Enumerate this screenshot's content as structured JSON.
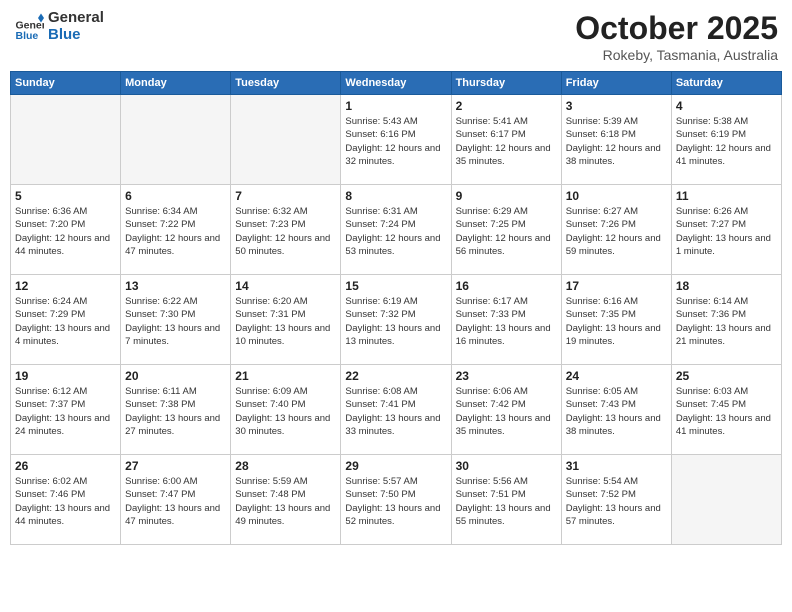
{
  "header": {
    "logo_line1": "General",
    "logo_line2": "Blue",
    "month": "October 2025",
    "location": "Rokeby, Tasmania, Australia"
  },
  "days_of_week": [
    "Sunday",
    "Monday",
    "Tuesday",
    "Wednesday",
    "Thursday",
    "Friday",
    "Saturday"
  ],
  "weeks": [
    [
      {
        "day": "",
        "empty": true
      },
      {
        "day": "",
        "empty": true
      },
      {
        "day": "",
        "empty": true
      },
      {
        "day": "1",
        "sunrise": "5:43 AM",
        "sunset": "6:16 PM",
        "daylight": "12 hours and 32 minutes."
      },
      {
        "day": "2",
        "sunrise": "5:41 AM",
        "sunset": "6:17 PM",
        "daylight": "12 hours and 35 minutes."
      },
      {
        "day": "3",
        "sunrise": "5:39 AM",
        "sunset": "6:18 PM",
        "daylight": "12 hours and 38 minutes."
      },
      {
        "day": "4",
        "sunrise": "5:38 AM",
        "sunset": "6:19 PM",
        "daylight": "12 hours and 41 minutes."
      }
    ],
    [
      {
        "day": "5",
        "sunrise": "6:36 AM",
        "sunset": "7:20 PM",
        "daylight": "12 hours and 44 minutes."
      },
      {
        "day": "6",
        "sunrise": "6:34 AM",
        "sunset": "7:22 PM",
        "daylight": "12 hours and 47 minutes."
      },
      {
        "day": "7",
        "sunrise": "6:32 AM",
        "sunset": "7:23 PM",
        "daylight": "12 hours and 50 minutes."
      },
      {
        "day": "8",
        "sunrise": "6:31 AM",
        "sunset": "7:24 PM",
        "daylight": "12 hours and 53 minutes."
      },
      {
        "day": "9",
        "sunrise": "6:29 AM",
        "sunset": "7:25 PM",
        "daylight": "12 hours and 56 minutes."
      },
      {
        "day": "10",
        "sunrise": "6:27 AM",
        "sunset": "7:26 PM",
        "daylight": "12 hours and 59 minutes."
      },
      {
        "day": "11",
        "sunrise": "6:26 AM",
        "sunset": "7:27 PM",
        "daylight": "13 hours and 1 minute."
      }
    ],
    [
      {
        "day": "12",
        "sunrise": "6:24 AM",
        "sunset": "7:29 PM",
        "daylight": "13 hours and 4 minutes."
      },
      {
        "day": "13",
        "sunrise": "6:22 AM",
        "sunset": "7:30 PM",
        "daylight": "13 hours and 7 minutes."
      },
      {
        "day": "14",
        "sunrise": "6:20 AM",
        "sunset": "7:31 PM",
        "daylight": "13 hours and 10 minutes."
      },
      {
        "day": "15",
        "sunrise": "6:19 AM",
        "sunset": "7:32 PM",
        "daylight": "13 hours and 13 minutes."
      },
      {
        "day": "16",
        "sunrise": "6:17 AM",
        "sunset": "7:33 PM",
        "daylight": "13 hours and 16 minutes."
      },
      {
        "day": "17",
        "sunrise": "6:16 AM",
        "sunset": "7:35 PM",
        "daylight": "13 hours and 19 minutes."
      },
      {
        "day": "18",
        "sunrise": "6:14 AM",
        "sunset": "7:36 PM",
        "daylight": "13 hours and 21 minutes."
      }
    ],
    [
      {
        "day": "19",
        "sunrise": "6:12 AM",
        "sunset": "7:37 PM",
        "daylight": "13 hours and 24 minutes."
      },
      {
        "day": "20",
        "sunrise": "6:11 AM",
        "sunset": "7:38 PM",
        "daylight": "13 hours and 27 minutes."
      },
      {
        "day": "21",
        "sunrise": "6:09 AM",
        "sunset": "7:40 PM",
        "daylight": "13 hours and 30 minutes."
      },
      {
        "day": "22",
        "sunrise": "6:08 AM",
        "sunset": "7:41 PM",
        "daylight": "13 hours and 33 minutes."
      },
      {
        "day": "23",
        "sunrise": "6:06 AM",
        "sunset": "7:42 PM",
        "daylight": "13 hours and 35 minutes."
      },
      {
        "day": "24",
        "sunrise": "6:05 AM",
        "sunset": "7:43 PM",
        "daylight": "13 hours and 38 minutes."
      },
      {
        "day": "25",
        "sunrise": "6:03 AM",
        "sunset": "7:45 PM",
        "daylight": "13 hours and 41 minutes."
      }
    ],
    [
      {
        "day": "26",
        "sunrise": "6:02 AM",
        "sunset": "7:46 PM",
        "daylight": "13 hours and 44 minutes."
      },
      {
        "day": "27",
        "sunrise": "6:00 AM",
        "sunset": "7:47 PM",
        "daylight": "13 hours and 47 minutes."
      },
      {
        "day": "28",
        "sunrise": "5:59 AM",
        "sunset": "7:48 PM",
        "daylight": "13 hours and 49 minutes."
      },
      {
        "day": "29",
        "sunrise": "5:57 AM",
        "sunset": "7:50 PM",
        "daylight": "13 hours and 52 minutes."
      },
      {
        "day": "30",
        "sunrise": "5:56 AM",
        "sunset": "7:51 PM",
        "daylight": "13 hours and 55 minutes."
      },
      {
        "day": "31",
        "sunrise": "5:54 AM",
        "sunset": "7:52 PM",
        "daylight": "13 hours and 57 minutes."
      },
      {
        "day": "",
        "empty": true
      }
    ]
  ]
}
